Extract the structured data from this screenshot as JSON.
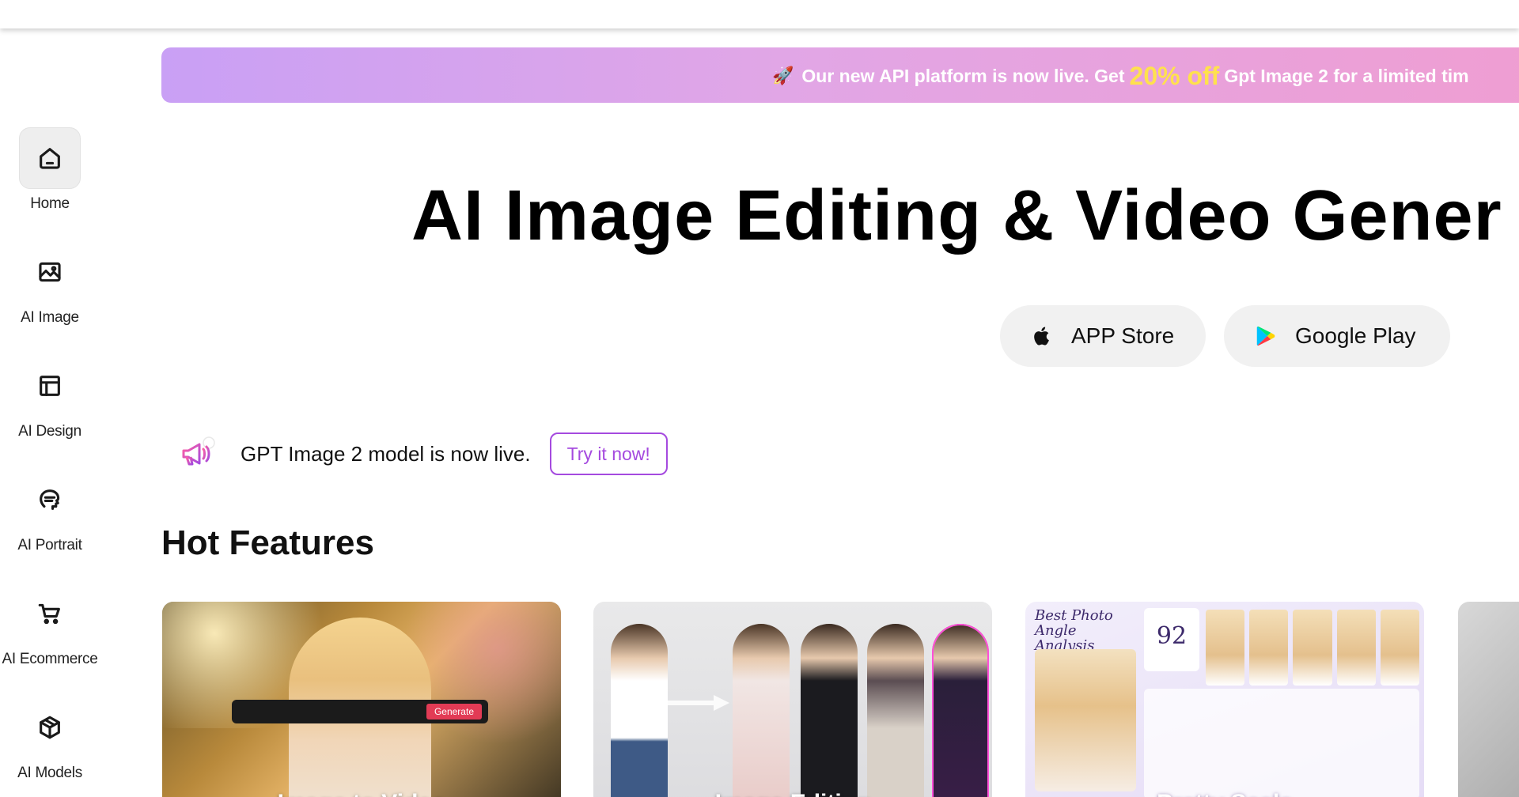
{
  "sidebar": {
    "items": [
      {
        "label": "Home",
        "icon": "home-icon",
        "active": true
      },
      {
        "label": "AI Image",
        "icon": "image-icon"
      },
      {
        "label": "AI Design",
        "icon": "layout-icon"
      },
      {
        "label": "AI Portrait",
        "icon": "face-profile-icon"
      },
      {
        "label": "AI Ecommerce",
        "icon": "cart-icon"
      },
      {
        "label": "AI Models",
        "icon": "cube-icon"
      }
    ]
  },
  "promo": {
    "prefix": "Our new API platform is now live. Get",
    "highlight": "20% off",
    "suffix": "Gpt Image 2 for a limited tim",
    "icon": "rocket-icon",
    "highlight_color": "#ffe14d"
  },
  "hero": {
    "title": "AI Image Editing & Video Gener"
  },
  "store": {
    "appstore_label": "APP Store",
    "googleplay_label": "Google Play"
  },
  "announcement": {
    "text": "GPT Image 2 model is now live.",
    "cta_label": "Try it now!",
    "icon": "megaphone-icon",
    "accent_color": "#a54adf"
  },
  "hot_features": {
    "title": "Hot Features",
    "cards": [
      {
        "title": "Image to Video",
        "generate_label": "Generate"
      },
      {
        "title": "Image Editing"
      },
      {
        "title": "Pretty Scale",
        "heading": "Best Photo Angle Analysis",
        "score": "92"
      },
      {
        "title": ""
      }
    ]
  }
}
